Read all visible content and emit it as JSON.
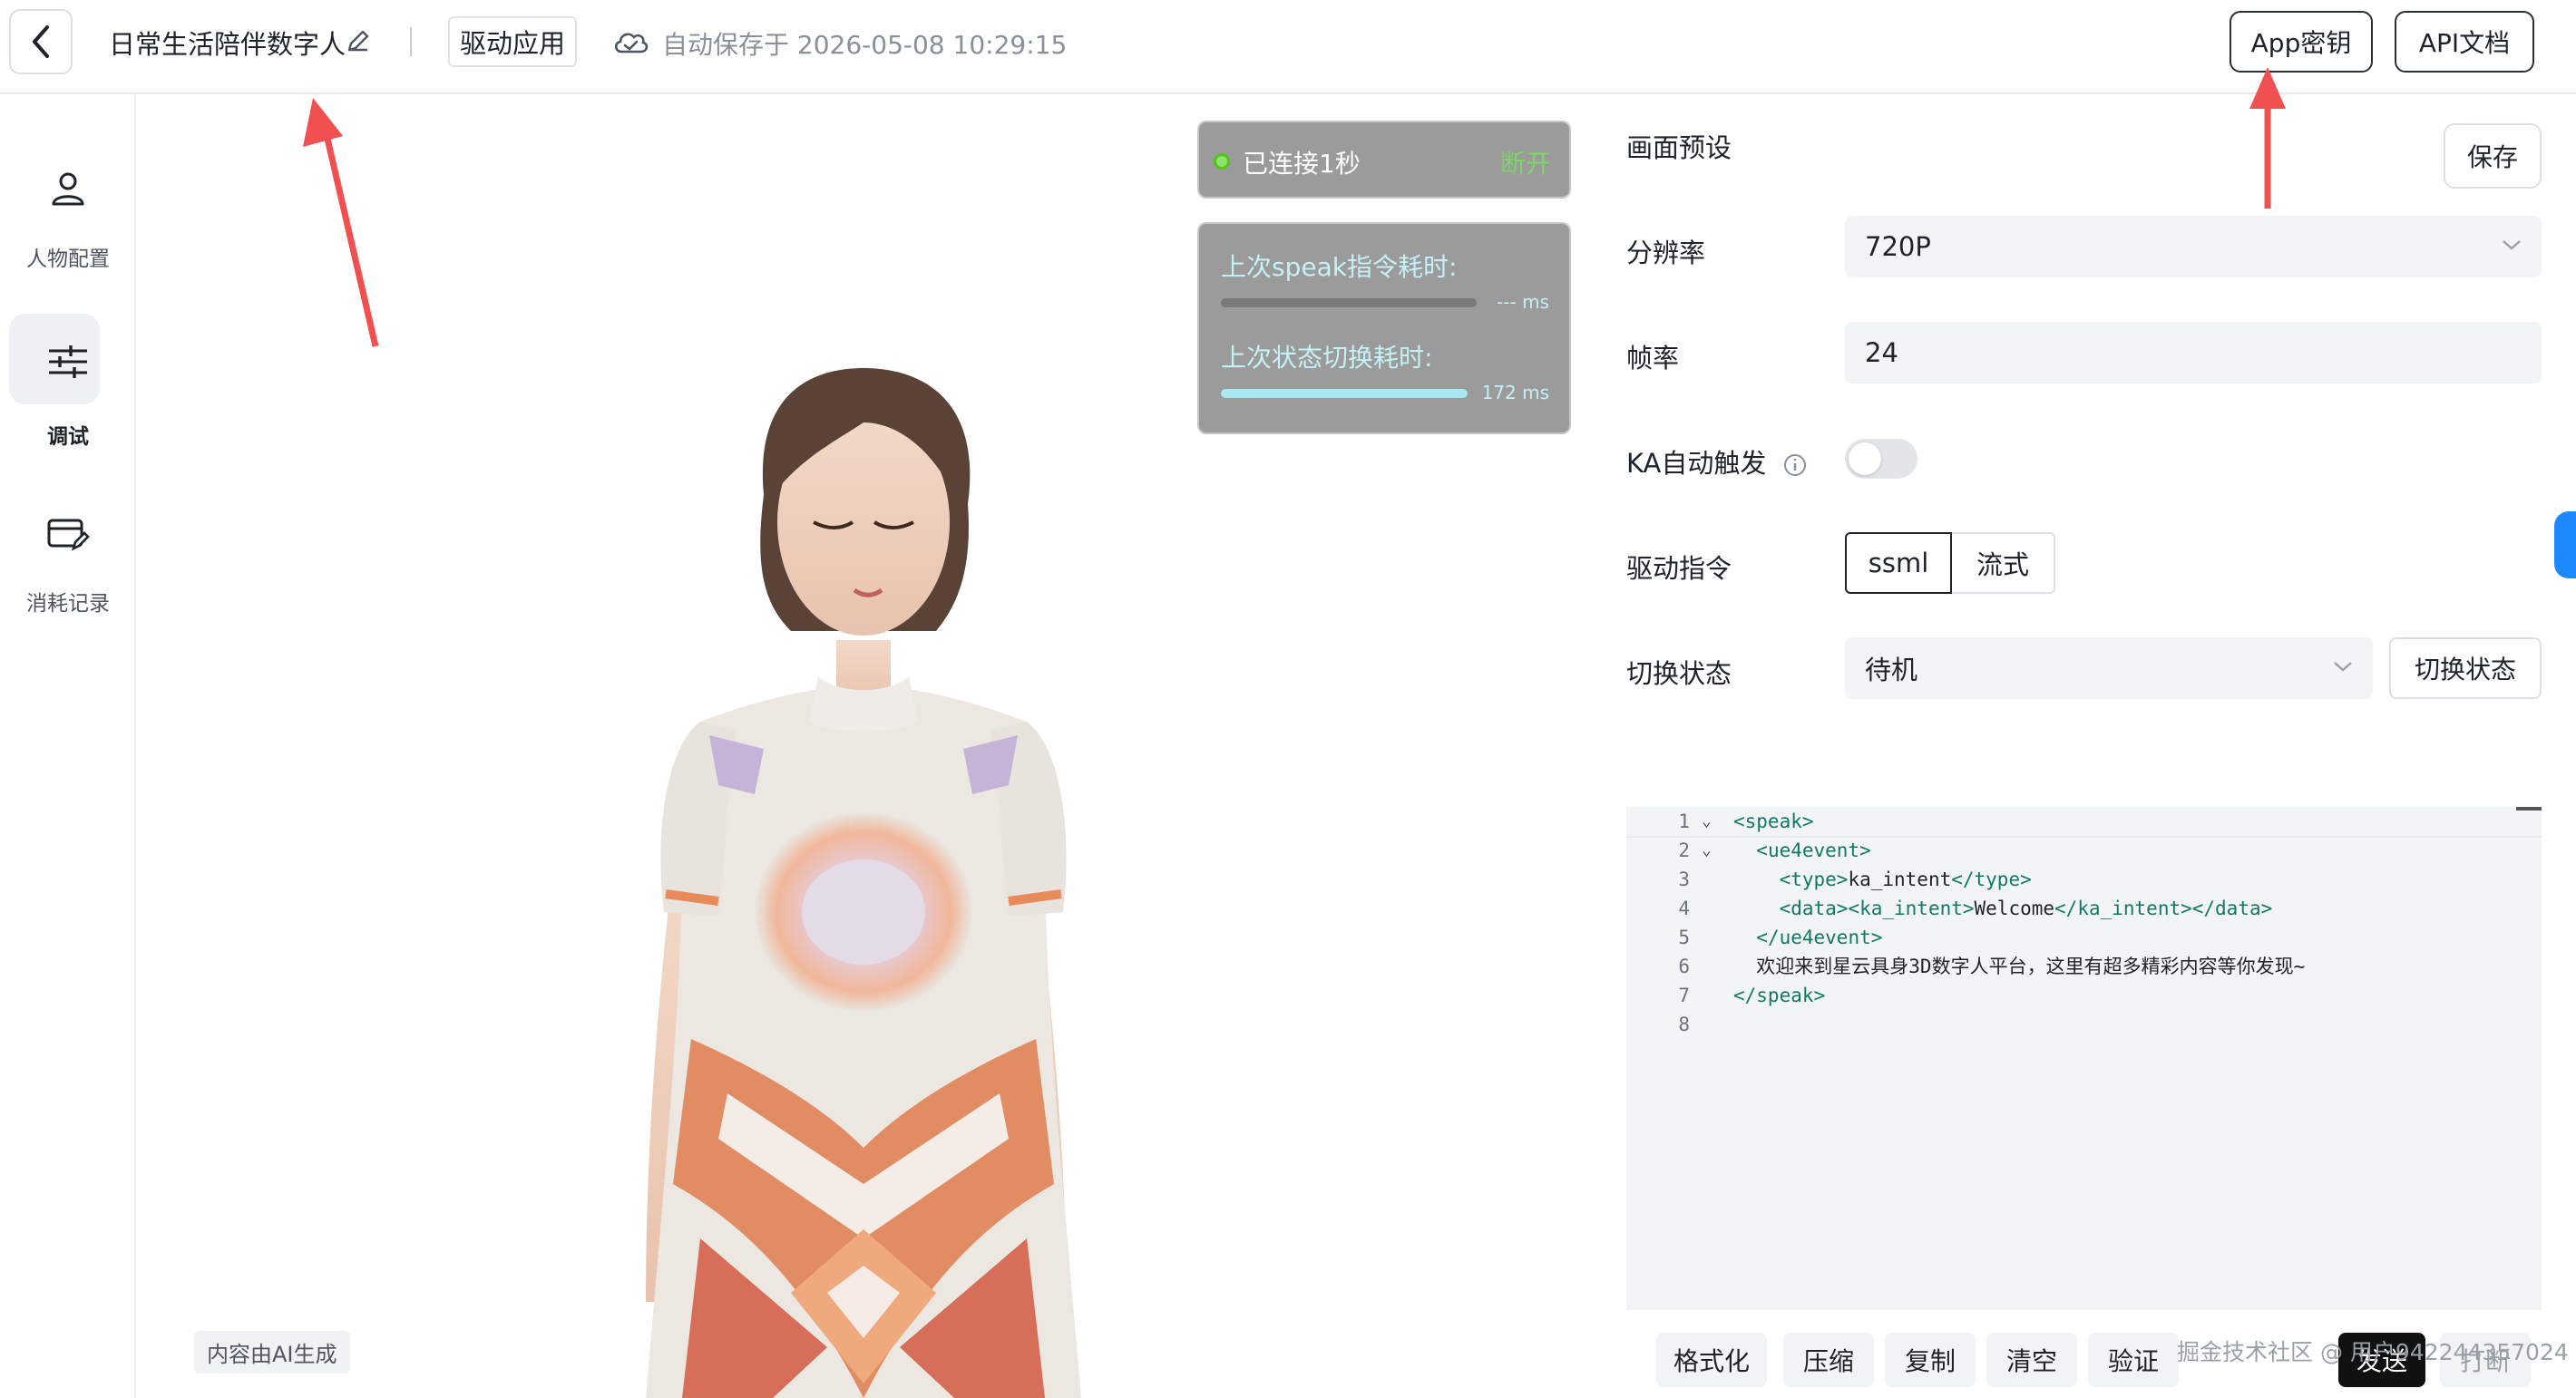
{
  "header": {
    "title": "日常生活陪伴数字人",
    "drive_app_label": "驱动应用",
    "autosave_text": "自动保存于 2026-05-08 10:29:15",
    "app_key_label": "App密钥",
    "api_docs_label": "API文档"
  },
  "sidebar": {
    "items": [
      {
        "label": "人物配置",
        "icon": "user-icon"
      },
      {
        "label": "调试",
        "icon": "sliders-icon",
        "active": true
      },
      {
        "label": "消耗记录",
        "icon": "card-edit-icon"
      }
    ]
  },
  "preview": {
    "connection_status": "已连接1秒",
    "disconnect_label": "断开",
    "speak_latency_label": "上次speak指令耗时:",
    "speak_latency_value": "--- ms",
    "speak_latency_fill": 0,
    "state_switch_label": "上次状态切换耗时:",
    "state_switch_value": "172 ms",
    "state_switch_fill": 1.0,
    "ai_tag": "内容由AI生成"
  },
  "panel": {
    "preset_label": "画面预设",
    "save_label": "保存",
    "resolution_label": "分辨率",
    "resolution_value": "720P",
    "framerate_label": "帧率",
    "framerate_value": "24",
    "ka_label": "KA自动触发",
    "ka_enabled": false,
    "drive_cmd_label": "驱动指令",
    "drive_cmd_options": [
      "ssml",
      "流式"
    ],
    "drive_cmd_selected": "ssml",
    "switch_state_label": "切换状态",
    "switch_state_value": "待机",
    "switch_state_button": "切换状态"
  },
  "editor": {
    "lines": [
      {
        "n": "1",
        "text": "<speak>"
      },
      {
        "n": "2",
        "text": "  <ue4event>"
      },
      {
        "n": "3",
        "text": "    <type>ka_intent</type>"
      },
      {
        "n": "4",
        "text": "    <data><ka_intent>Welcome</ka_intent></data>"
      },
      {
        "n": "5",
        "text": "  </ue4event>"
      },
      {
        "n": "6",
        "text": "  欢迎来到星云具身3D数字人平台，这里有超多精彩内容等你发现~"
      },
      {
        "n": "7",
        "text": "</speak>"
      },
      {
        "n": "8",
        "text": ""
      }
    ],
    "buttons": [
      "格式化",
      "压缩",
      "复制",
      "清空",
      "验证"
    ],
    "send_label": "发送",
    "interrupt_label": "打断"
  },
  "watermark": "掘金技术社区 @ 用户942244357024",
  "colors": {
    "accent_blue": "#1e88ff",
    "annotation_red": "#f05050",
    "code_tag": "#117a65",
    "connected_green": "#52c41a",
    "progress_cyan": "#a8e8f0"
  }
}
